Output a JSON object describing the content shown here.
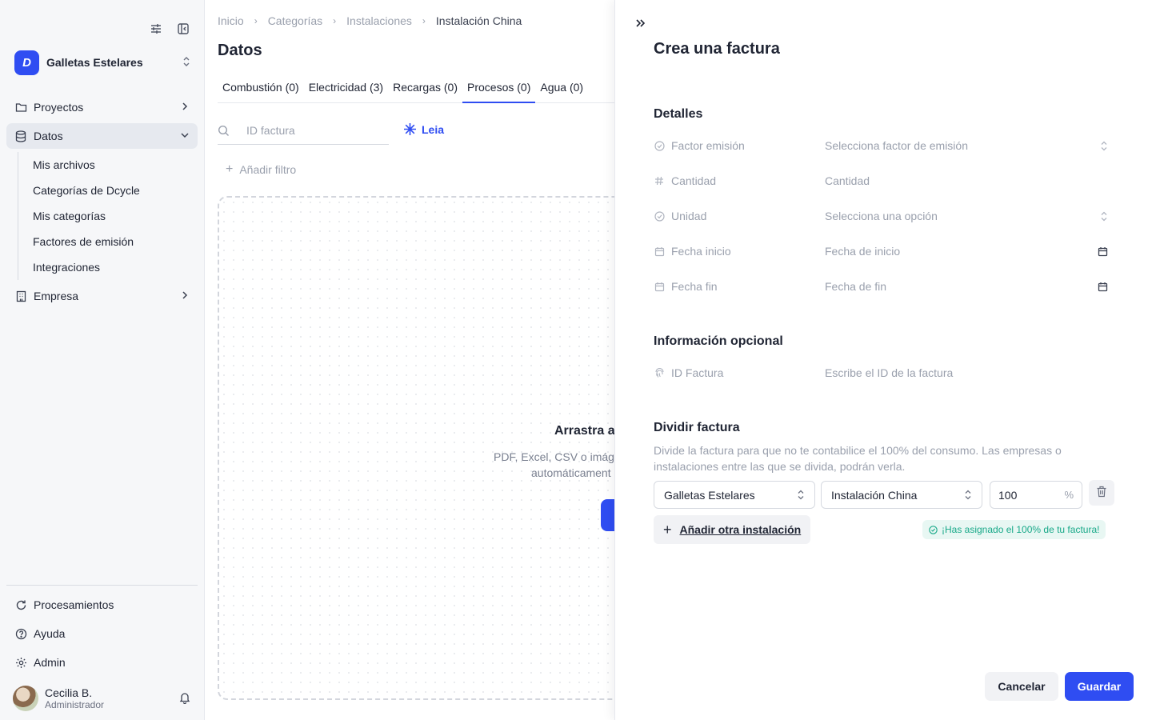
{
  "sidebar": {
    "company": {
      "name": "Galletas Estelares",
      "logo_letter": "D"
    },
    "nav": [
      {
        "label": "Proyectos",
        "icon": "folder-icon"
      },
      {
        "label": "Datos",
        "icon": "database-icon"
      },
      {
        "label": "Empresa",
        "icon": "building-icon"
      }
    ],
    "datos_sub": [
      "Mis archivos",
      "Categorías de Dcycle",
      "Mis categorías",
      "Factores de emisión",
      "Integraciones"
    ],
    "bottom_nav": [
      {
        "label": "Procesamientos",
        "icon": "refresh-icon"
      },
      {
        "label": "Ayuda",
        "icon": "help-icon"
      },
      {
        "label": "Admin",
        "icon": "gear-icon"
      }
    ],
    "user": {
      "name": "Cecilia B.",
      "role": "Administrador"
    }
  },
  "main": {
    "breadcrumb": [
      "Inicio",
      "Categorías",
      "Instalaciones",
      "Instalación China"
    ],
    "title": "Datos",
    "tabs": [
      "Combustión (0)",
      "Electricidad (3)",
      "Recargas (0)",
      "Procesos (0)",
      "Agua (0)"
    ],
    "active_tab": 3,
    "search_placeholder": "ID factura",
    "leia_label": "Leia",
    "add_filter_label": "Añadir filtro",
    "dropzone": {
      "title": "Arrastra a",
      "line1": "PDF, Excel, CSV o imág",
      "line2": "automáticament"
    }
  },
  "drawer": {
    "title": "Crea una factura",
    "details_title": "Detalles",
    "fields": {
      "factor": {
        "label": "Factor emisión",
        "placeholder": "Selecciona factor de emisión"
      },
      "cantidad": {
        "label": "Cantidad",
        "placeholder": "Cantidad"
      },
      "unidad": {
        "label": "Unidad",
        "placeholder": "Selecciona una opción"
      },
      "fecha_inicio": {
        "label": "Fecha inicio",
        "placeholder": "Fecha de inicio"
      },
      "fecha_fin": {
        "label": "Fecha fin",
        "placeholder": "Fecha de fin"
      },
      "id_factura": {
        "label": "ID Factura",
        "placeholder": "Escribe el ID de la factura"
      }
    },
    "optional_title": "Información opcional",
    "split": {
      "title": "Dividir factura",
      "description": "Divide la factura para que no te contabilice el 100% del consumo. Las empresas o instalaciones entre las que se divida, podrán verla.",
      "company": "Galletas Estelares",
      "facility": "Instalación China",
      "percentage": "100",
      "percent_unit": "%",
      "add_label": "Añadir otra instalación",
      "assigned_badge": "¡Has asignado el 100% de tu factura!"
    },
    "cancel_label": "Cancelar",
    "save_label": "Guardar"
  },
  "colors": {
    "accent": "#2f4df2",
    "success": "#17a888",
    "sidebar_bg": "#f6f7f9"
  }
}
